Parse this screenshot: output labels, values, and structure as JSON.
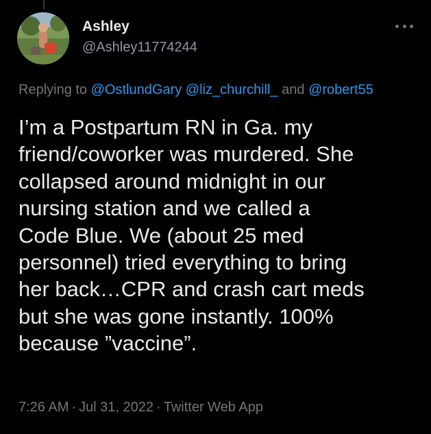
{
  "tweet": {
    "author_name": "Ashley",
    "author_handle": "@Ashley11774244",
    "replying_prefix": "Replying to",
    "mention_1": "@OstlundGary",
    "mention_2": "@liz_churchill_",
    "replying_and": "and",
    "mention_3": "@robert55",
    "body_lines": [
      "I’m a Postpartum RN in Ga. my",
      "friend/coworker was murdered. She",
      "collapsed around midnight in our",
      "nursing station and we called a",
      "Code Blue. We (about 25 med",
      "personnel) tried everything to bring",
      "her back…CPR and crash cart meds",
      "but she was gone instantly. 100%",
      "because ”vaccine”."
    ],
    "time": "7:26 AM",
    "separator": "·",
    "date": "Jul 31, 2022",
    "source": "Twitter Web App"
  },
  "icons": {
    "more": "more-options-icon",
    "avatar": "user-avatar"
  },
  "colors": {
    "background": "#000000",
    "text_primary": "#e7e9ea",
    "text_secondary": "#71767b",
    "link": "#1d9bf0"
  }
}
